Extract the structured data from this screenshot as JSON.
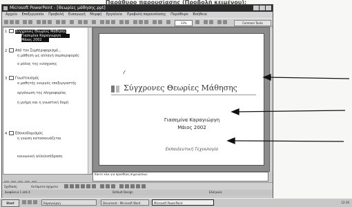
{
  "caption": "Παράθυρο παρουσίασης (Προβολή κειμένου):",
  "window": {
    "title": "Microsoft PowerPoint - [Θεωρίες μάθησης.ppt]",
    "menu": [
      "Αρχείο",
      "Επεξεργασία",
      "Προβολή",
      "Εισαγωγή",
      "Μορφή",
      "Εργαλεία",
      "Προβολή παρουσίασης",
      "Παράθυρο",
      "Βοήθεια"
    ],
    "zoom": "33%",
    "layout_button": "Common Tasks"
  },
  "outline": {
    "items": [
      {
        "num": "1",
        "title": "Σύγχρονες Θεωρίες Μάθησης",
        "bullets": [
          "Γιασεμίνα Καραγιώργη",
          "Μάιος 2002"
        ]
      },
      {
        "num": "2",
        "title": "Από τον Συμπεριφορισμό...",
        "bullets": [
          "η μάθηση ως αλλαγή συμπεριφοράς",
          "ο ρόλος της ενίσχυσης"
        ]
      },
      {
        "num": "3",
        "title": "Γνωστικισμός",
        "bullets": [
          "ο μαθητής ενεργός επεξεργαστής",
          "οργάνωση της πληροφορίας",
          "η μνήμη και η γνωστική δομή"
        ]
      },
      {
        "num": "4",
        "title": "Εποικοδομισμός",
        "bullets": [
          "η γνώση κατασκευάζεται",
          "κοινωνική αλληλεπίδραση"
        ]
      }
    ]
  },
  "slide": {
    "title": "Σύγχρονες Θεωρίες Μάθησης",
    "subtitle1": "Γιασεμίνα Καραγιώργη",
    "subtitle2": "Μάιος 2002",
    "subtitle3": "Εκπαιδευτική Τεχνολογία"
  },
  "notes_placeholder": "Κάντε κλικ για προσθήκη σημειώσεων",
  "drawbar": {
    "label": "Σχεδίαση",
    "autoshapes": "Αυτόματα σχήματα"
  },
  "statusbar": {
    "slide": "Διαφάνεια 1 από 4",
    "design": "Default Design",
    "lang": "Ελληνικά"
  },
  "taskbar": {
    "start": "Start",
    "tasks": [
      "Καραγιώργη",
      "Document - Microsoft Word",
      "Microsoft PowerPoint"
    ],
    "clock": "12:10"
  }
}
